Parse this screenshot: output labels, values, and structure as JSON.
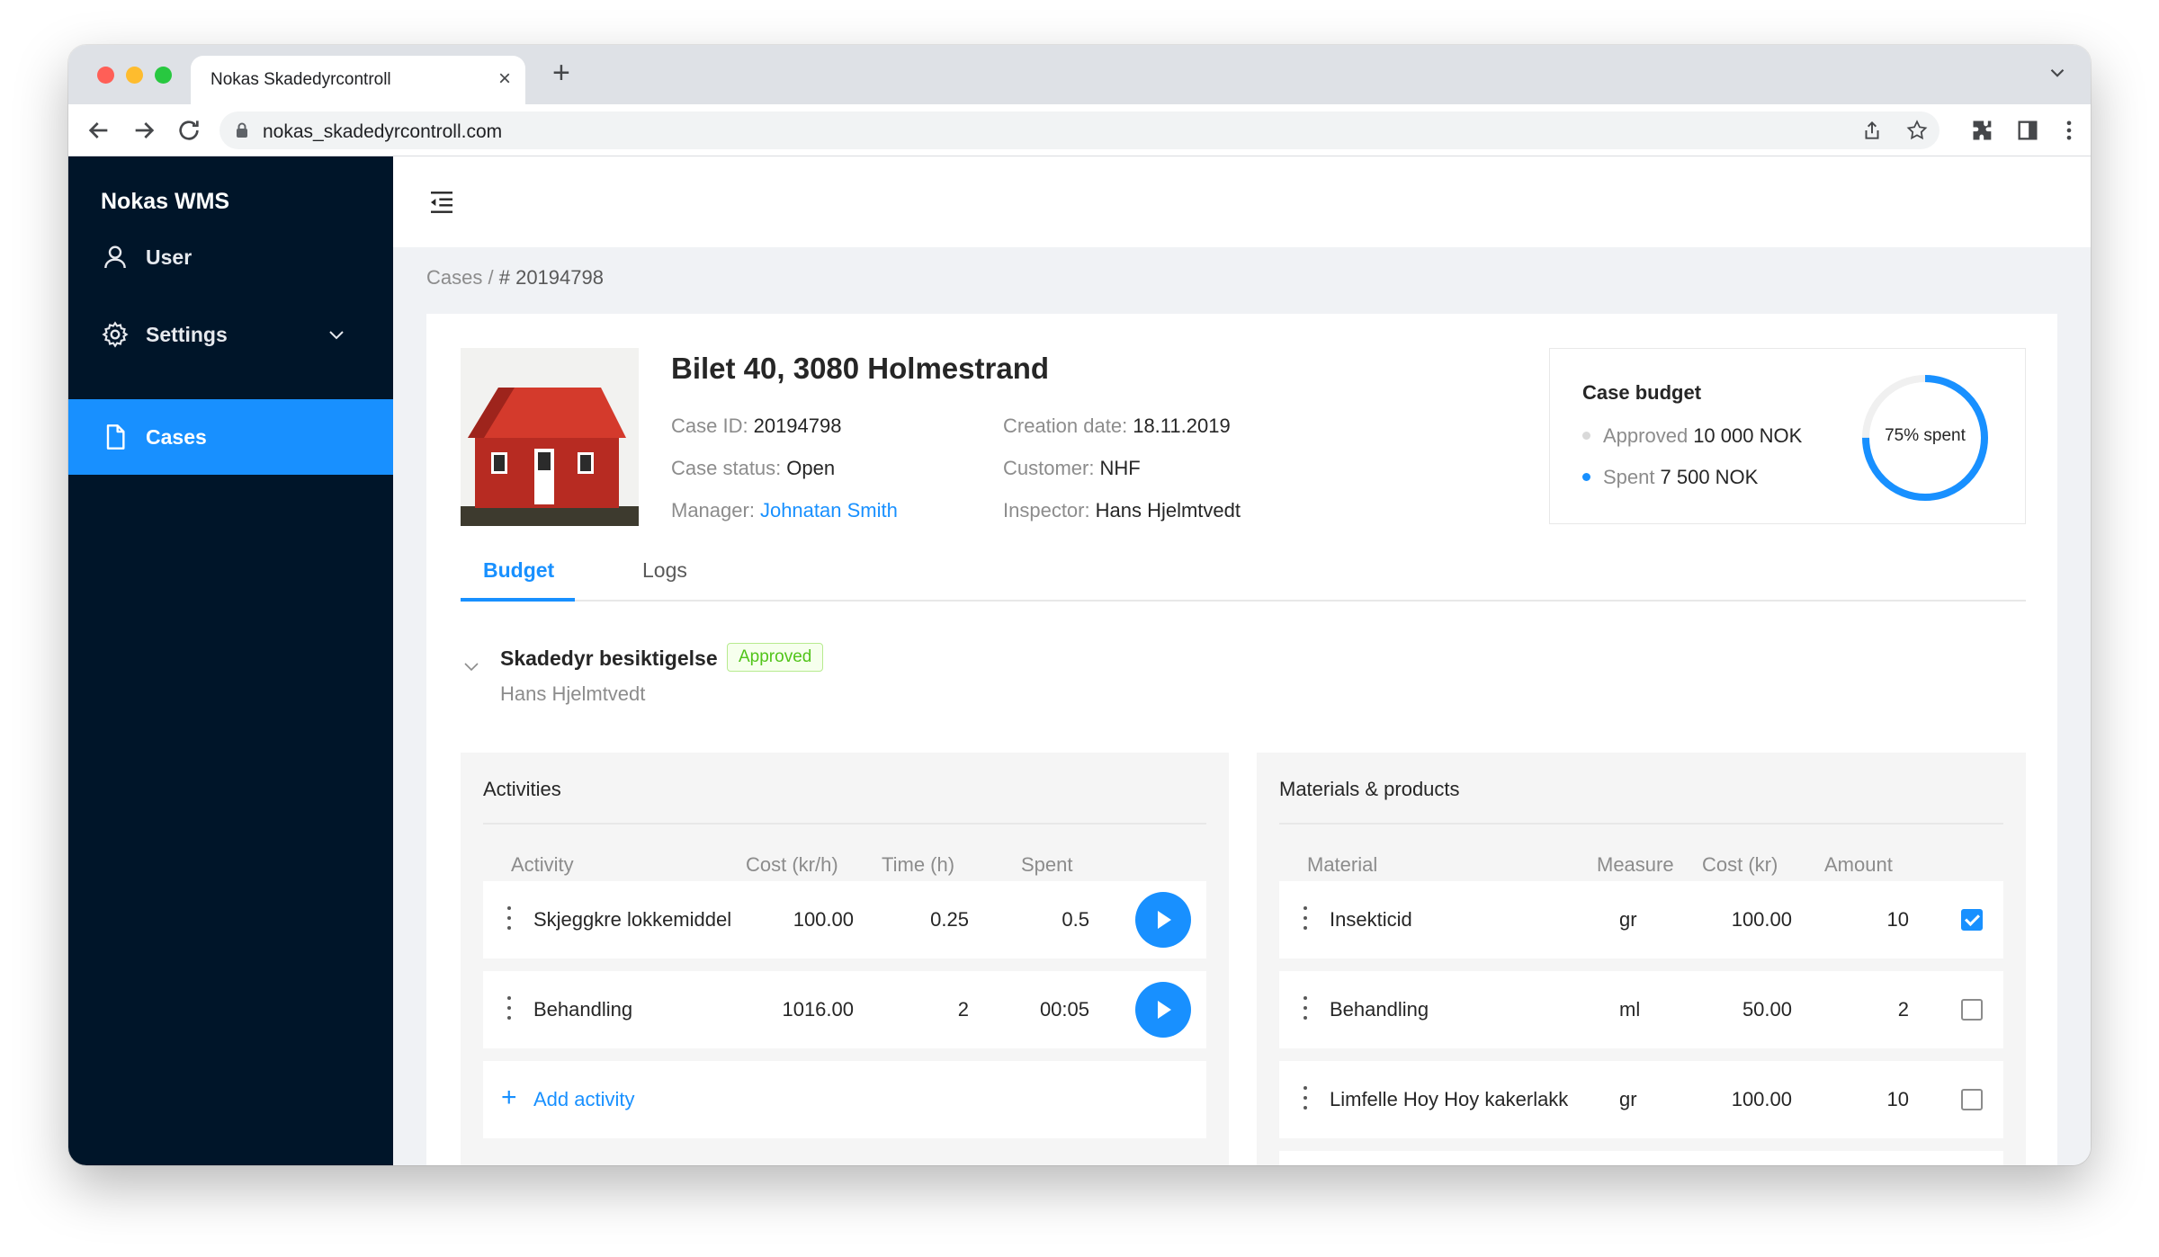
{
  "browser": {
    "tab_title": "Nokas Skadedyrcontroll",
    "tab_close": "×",
    "new_tab": "+",
    "url": "nokas_skadedyrcontroll.com"
  },
  "sidebar": {
    "brand": "Nokas WMS",
    "items": [
      {
        "label": "User",
        "icon": "user-icon"
      },
      {
        "label": "Settings",
        "icon": "gear-icon"
      },
      {
        "label": "Cases",
        "icon": "file-icon",
        "active": true
      }
    ]
  },
  "breadcrumb": {
    "parent": "Cases",
    "separator": "/",
    "current": "# 20194798"
  },
  "case": {
    "title": "Bilet 40, 3080 Holmestrand",
    "id_label": "Case ID:",
    "id_value": "20194798",
    "status_label": "Case status:",
    "status_value": "Open",
    "manager_label": "Manager:",
    "manager_value": "Johnatan Smith",
    "created_label": "Creation date:",
    "created_value": "18.11.2019",
    "customer_label": "Customer:",
    "customer_value": "NHF",
    "inspector_label": "Inspector:",
    "inspector_value": "Hans Hjelmtvedt"
  },
  "budget": {
    "title": "Case budget",
    "approved_label": "Approved",
    "approved_value": "10 000 NOK",
    "spent_label": "Spent",
    "spent_value": "7 500 NOK",
    "donut_label": "75% spent",
    "spent_fraction": 0.75,
    "colors": {
      "spent": "#1890ff",
      "approved": "#d9d9d9"
    }
  },
  "tabs": {
    "budget": "Budget",
    "logs": "Logs"
  },
  "section": {
    "title": "Skadedyr besiktigelse",
    "badge": "Approved",
    "subtitle": "Hans Hjelmtvedt"
  },
  "activities": {
    "title": "Activities",
    "columns": [
      "Activity",
      "Cost (kr/h)",
      "Time (h)",
      "Spent"
    ],
    "rows": [
      {
        "activity": "Skjeggkre lokkemiddel",
        "cost": "100.00",
        "time": "0.25",
        "spent": "0.5"
      },
      {
        "activity": "Behandling",
        "cost": "1016.00",
        "time": "2",
        "spent": "00:05"
      }
    ],
    "add_label": "Add activity"
  },
  "materials": {
    "title": "Materials & products",
    "columns": [
      "Material",
      "Measure",
      "Cost (kr)",
      "Amount"
    ],
    "rows": [
      {
        "material": "Insekticid",
        "measure": "gr",
        "cost": "100.00",
        "amount": "10",
        "checked": true
      },
      {
        "material": "Behandling",
        "measure": "ml",
        "cost": "50.00",
        "amount": "2",
        "checked": false
      },
      {
        "material": "Limfelle Hoy Hoy kakerlakk",
        "measure": "gr",
        "cost": "100.00",
        "amount": "10",
        "checked": false
      }
    ]
  },
  "theme": {
    "accent": "#1890ff",
    "sidebar_bg": "#001529",
    "success": "#52c41a"
  }
}
